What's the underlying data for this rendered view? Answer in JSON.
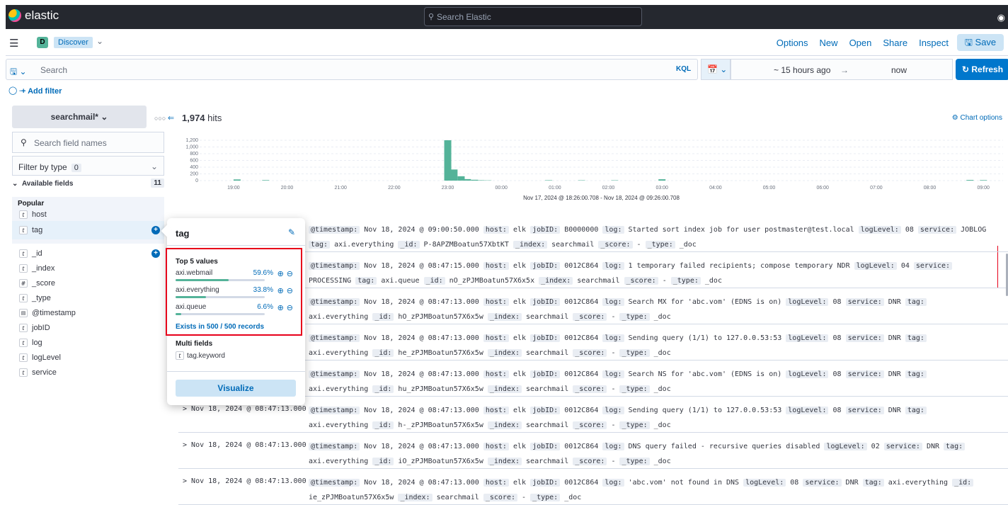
{
  "topbar": {
    "brand": "elastic",
    "search_placeholder": "Search Elastic"
  },
  "header": {
    "space_badge": "D",
    "app_label": "Discover",
    "menu": [
      "Options",
      "New",
      "Open",
      "Share",
      "Inspect"
    ],
    "save_label": "Save"
  },
  "query": {
    "placeholder": "Search",
    "language": "KQL",
    "time_start": "~ 15 hours ago",
    "time_arrow": "→",
    "time_end": "now",
    "refresh_label": "Refresh"
  },
  "filter": {
    "add_label": "+ Add filter"
  },
  "sidebar": {
    "index_pattern": "searchmail*",
    "search_placeholder": "Search field names",
    "filter_by_type_label": "Filter by type",
    "filter_by_type_count": "0",
    "available_label": "Available fields",
    "available_count": "11",
    "popular_label": "Popular",
    "popular_fields": [
      {
        "type": "t",
        "name": "host"
      },
      {
        "type": "t",
        "name": "tag"
      }
    ],
    "fields": [
      {
        "type": "t",
        "name": "_id"
      },
      {
        "type": "t",
        "name": "_index"
      },
      {
        "type": "#",
        "name": "_score"
      },
      {
        "type": "t",
        "name": "_type"
      },
      {
        "type": "date",
        "name": "@timestamp"
      },
      {
        "type": "t",
        "name": "jobID"
      },
      {
        "type": "t",
        "name": "log"
      },
      {
        "type": "t",
        "name": "logLevel"
      },
      {
        "type": "t",
        "name": "service"
      }
    ]
  },
  "popover": {
    "title": "tag",
    "top_values_title": "Top 5 values",
    "values": [
      {
        "name": "axi.webmail",
        "percent_label": "59.6%",
        "percent": 59.6
      },
      {
        "name": "axi.everything",
        "percent_label": "33.8%",
        "percent": 33.8
      },
      {
        "name": "axi.queue",
        "percent_label": "6.6%",
        "percent": 6.6
      }
    ],
    "exists_label": "Exists in 500 / 500 records",
    "multi_title": "Multi fields",
    "multi_field": "tag.keyword",
    "visualize_label": "Visualize"
  },
  "hits": {
    "count": "1,974",
    "suffix": " hits",
    "chart_options_label": "Chart options"
  },
  "chart_data": {
    "type": "bar",
    "title": "",
    "y_ticks": [
      "1,200",
      "1,000",
      "800",
      "600",
      "400",
      "200",
      "0"
    ],
    "ylim": [
      0,
      1200
    ],
    "x_ticks": [
      "19:00",
      "20:00",
      "21:00",
      "22:00",
      "23:00",
      "00:00",
      "01:00",
      "02:00",
      "03:00",
      "04:00",
      "05:00",
      "06:00",
      "07:00",
      "08:00",
      "09:00"
    ],
    "xlabel": "Nov 17, 2024 @ 18:26:00.708 - Nov 18, 2024 @ 09:26:00.708",
    "bars": [
      {
        "time": "19:04",
        "value": 35
      },
      {
        "time": "19:36",
        "value": 15
      },
      {
        "time": "23:00",
        "value": 1200
      },
      {
        "time": "23:07",
        "value": 330
      },
      {
        "time": "23:15",
        "value": 130
      },
      {
        "time": "23:22",
        "value": 45
      },
      {
        "time": "23:30",
        "value": 25
      },
      {
        "time": "23:37",
        "value": 12
      },
      {
        "time": "23:45",
        "value": 8
      },
      {
        "time": "00:53",
        "value": 12
      },
      {
        "time": "01:30",
        "value": 10
      },
      {
        "time": "02:07",
        "value": 10
      },
      {
        "time": "03:00",
        "value": 40
      },
      {
        "time": "08:45",
        "value": 20
      },
      {
        "time": "09:00",
        "value": 15
      }
    ],
    "color": "#54b399"
  },
  "docs": [
    {
      "ts": "",
      "timestamp": "Nov 18, 2024 @ 09:00:50.000",
      "host": "elk",
      "jobID": "B0000000",
      "log": "Started sort index job for user postmaster@test.local",
      "logLevel": "08",
      "service": "JOBLOG",
      "tag": "axi.everything",
      "id": "P-8APZMBoatun57XbtKT",
      "index": "searchmail",
      "score": "-",
      "type": "_doc"
    },
    {
      "ts": "",
      "timestamp": "Nov 18, 2024 @ 08:47:15.000",
      "host": "elk",
      "jobID": "0012C864",
      "log": "1 temporary failed recipients; compose temporary NDR",
      "logLevel": "04",
      "service": "PROCESSING",
      "tag": "axi.queue",
      "id": "nO_zPJMBoatun57X6x5x",
      "index": "searchmail",
      "score": "-",
      "type": "_doc"
    },
    {
      "ts": "",
      "timestamp": "Nov 18, 2024 @ 08:47:13.000",
      "host": "elk",
      "jobID": "0012C864",
      "log": "Search MX for 'abc.vom' (EDNS is on)",
      "logLevel": "08",
      "service": "DNR",
      "tag": "axi.everything",
      "id": "hO_zPJMBoatun57X6x5w",
      "index": "searchmail",
      "score": "-",
      "type": "_doc"
    },
    {
      "ts": "",
      "timestamp": "Nov 18, 2024 @ 08:47:13.000",
      "host": "elk",
      "jobID": "0012C864",
      "log": "Sending query (1/1) to 127.0.0.53:53",
      "logLevel": "08",
      "service": "DNR",
      "tag": "axi.everything",
      "id": "he_zPJMBoatun57X6x5w",
      "index": "searchmail",
      "score": "-",
      "type": "_doc"
    },
    {
      "ts": "",
      "timestamp": "Nov 18, 2024 @ 08:47:13.000",
      "host": "elk",
      "jobID": "0012C864",
      "log": "Search NS for 'abc.vom' (EDNS is on)",
      "logLevel": "08",
      "service": "DNR",
      "tag": "axi.everything",
      "id": "hu_zPJMBoatun57X6x5w",
      "index": "searchmail",
      "score": "-",
      "type": "_doc"
    },
    {
      "ts": "Nov 18, 2024 @ 08:47:13.000",
      "timestamp": "Nov 18, 2024 @ 08:47:13.000",
      "host": "elk",
      "jobID": "0012C864",
      "log": "Sending query (1/1) to 127.0.0.53:53",
      "logLevel": "08",
      "service": "DNR",
      "tag": "axi.everything",
      "id": "h-_zPJMBoatun57X6x5w",
      "index": "searchmail",
      "score": "-",
      "type": "_doc"
    },
    {
      "ts": "Nov 18, 2024 @ 08:47:13.000",
      "timestamp": "Nov 18, 2024 @ 08:47:13.000",
      "host": "elk",
      "jobID": "0012C864",
      "log": "DNS query failed - recursive queries disabled",
      "logLevel": "02",
      "service": "DNR",
      "tag": "axi.everything",
      "id": "iO_zPJMBoatun57X6x5w",
      "index": "searchmail",
      "score": "-",
      "type": "_doc"
    },
    {
      "ts": "Nov 18, 2024 @ 08:47:13.000",
      "timestamp": "Nov 18, 2024 @ 08:47:13.000",
      "host": "elk",
      "jobID": "0012C864",
      "log": "'abc.vom' not found in DNS",
      "logLevel": "08",
      "service": "DNR",
      "tag": "axi.everything",
      "id": "ie_zPJMBoatun57X6x5w",
      "index": "searchmail",
      "score": "-",
      "type": "_doc"
    }
  ]
}
